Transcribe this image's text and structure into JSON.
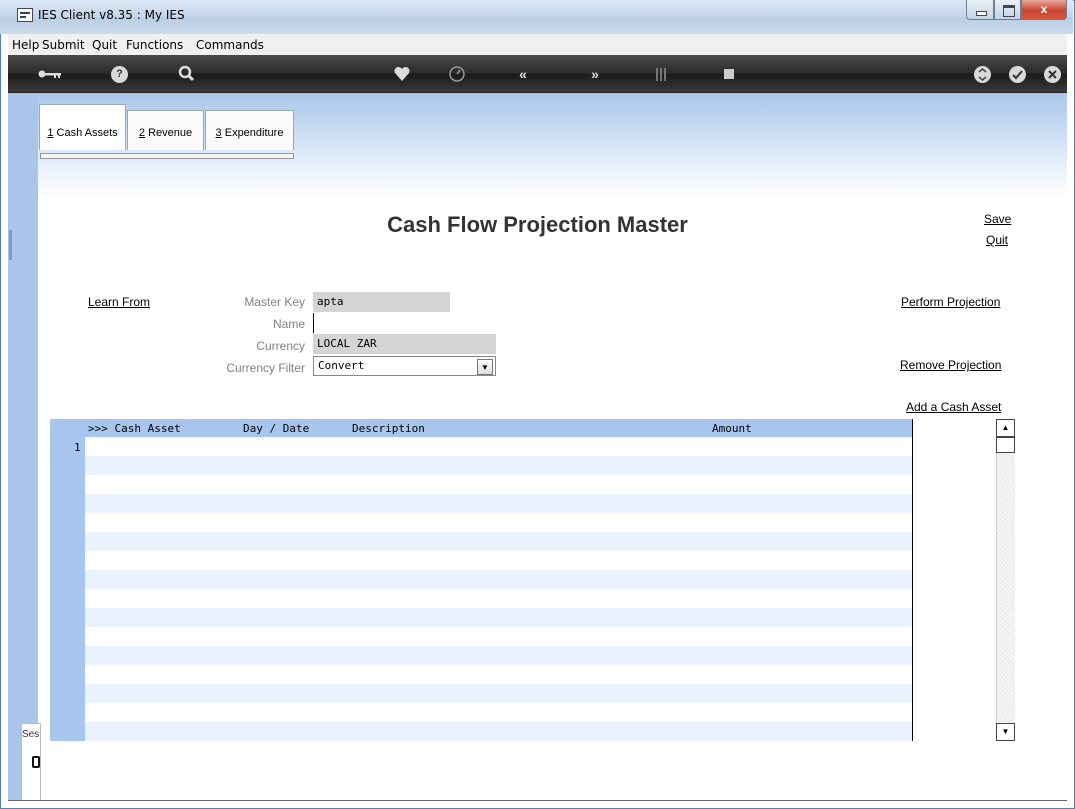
{
  "window": {
    "title": "IES Client v8.35 : My IES",
    "close_label": "x"
  },
  "menu": {
    "items": [
      "Help",
      "Submit",
      "Quit",
      "Functions",
      "Commands"
    ]
  },
  "toolbar": {
    "icons": [
      "key-icon",
      "help-icon",
      "search-icon",
      "heart-icon",
      "clock-icon",
      "rewind-icon",
      "fast-forward-icon",
      "flag-icon",
      "square-icon",
      "recycle-icon",
      "check-icon",
      "close-icon"
    ]
  },
  "tabs": [
    {
      "key": "1",
      "label": " Cash Assets"
    },
    {
      "key": "2",
      "label": " Revenue"
    },
    {
      "key": "3",
      "label": " Expenditure"
    }
  ],
  "page": {
    "title": "Cash Flow Projection Master"
  },
  "actions": {
    "save": "Save",
    "quit": "Quit",
    "learn_from": "Learn From",
    "perform_projection": "Perform Projection",
    "remove_projection": "Remove Projection",
    "add_cash_asset": "Add a Cash Asset"
  },
  "form": {
    "master_key": {
      "label": "Master Key",
      "value": "apta"
    },
    "name": {
      "label": "Name",
      "value": ""
    },
    "currency": {
      "label": "Currency",
      "value": "LOCAL ZAR"
    },
    "currency_filter": {
      "label": "Currency Filter",
      "value": "Convert"
    }
  },
  "grid": {
    "columns": [
      ">>> Cash Asset",
      "Day / Date",
      "Description",
      "Amount"
    ],
    "row_number": "1"
  },
  "session": {
    "label": "Ses"
  }
}
